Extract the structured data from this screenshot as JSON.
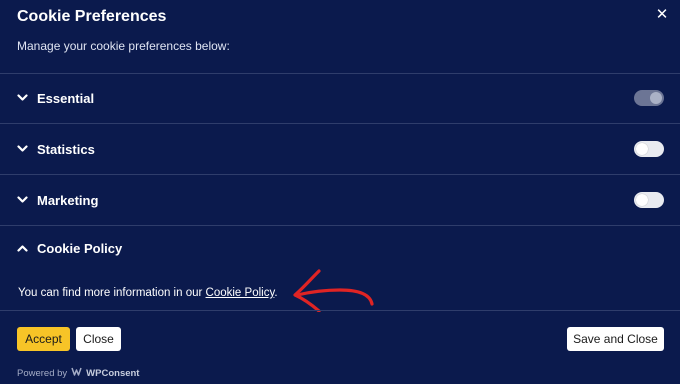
{
  "header": {
    "title": "Cookie Preferences",
    "subtitle": "Manage your cookie preferences below:",
    "close_icon": "close-icon"
  },
  "categories": [
    {
      "label": "Essential",
      "state": "collapsed",
      "toggle": "on-disabled"
    },
    {
      "label": "Statistics",
      "state": "collapsed",
      "toggle": "off"
    },
    {
      "label": "Marketing",
      "state": "collapsed",
      "toggle": "off"
    }
  ],
  "policy": {
    "label": "Cookie Policy",
    "state": "expanded",
    "text": "You can find more information in our",
    "link_text": "Cookie Policy",
    "period": "."
  },
  "buttons": {
    "accept": "Accept",
    "close": "Close",
    "save_and_close": "Save and Close"
  },
  "footer": {
    "powered_by": "Powered by",
    "brand": "WPConsent"
  },
  "colors": {
    "background": "#0b1a4d",
    "accept": "#f7c427",
    "annotation_arrow": "#e02424"
  }
}
